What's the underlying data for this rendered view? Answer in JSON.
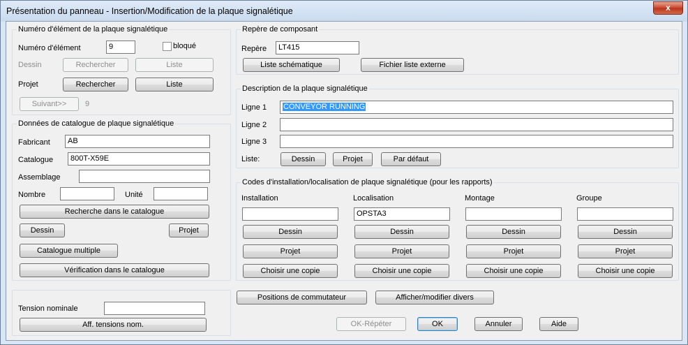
{
  "window": {
    "title": "Présentation du panneau - Insertion/Modification de la plaque signalétique",
    "close_glyph": "x"
  },
  "element_group": {
    "title": "Numéro d'élément de la plaque signalétique",
    "number_label": "Numéro d'élément",
    "number_value": "9",
    "locked_label": "bloqué",
    "drawing_label": "Dessin",
    "project_label": "Projet",
    "search_label": "Rechercher",
    "list_label": "Liste",
    "next_label": "Suivant>>",
    "next_value": "9"
  },
  "catalog_group": {
    "title": "Données de catalogue de plaque signalétique",
    "manufacturer_label": "Fabricant",
    "manufacturer_value": "AB",
    "catalog_label": "Catalogue",
    "catalog_value": "800T-X59E",
    "assembly_label": "Assemblage",
    "assembly_value": "",
    "count_label": "Nombre",
    "count_value": "",
    "unit_label": "Unité",
    "unit_value": "",
    "catalog_search_label": "Recherche dans le catalogue",
    "drawing_label": "Dessin",
    "project_label": "Projet",
    "multi_catalog_label": "Catalogue multiple",
    "catalog_check_label": "Vérification dans le catalogue"
  },
  "voltage_group": {
    "nominal_label": "Tension nominale",
    "nominal_value": "",
    "show_voltages_label": "Aff. tensions nom."
  },
  "component_tag_group": {
    "title": "Repère de composant",
    "tag_label": "Repère",
    "tag_value": "LT415",
    "schematic_list_label": "Liste schématique",
    "external_file_label": "Fichier liste externe"
  },
  "description_group": {
    "title": "Description de la plaque signalétique",
    "line1_label": "Ligne 1",
    "line1_value": "CONVEYOR RUNNING",
    "line2_label": "Ligne 2",
    "line2_value": "",
    "line3_label": "Ligne 3",
    "line3_value": "",
    "list_label": "Liste:",
    "drawing_label": "Dessin",
    "project_label": "Projet",
    "default_label": "Par défaut"
  },
  "codes_group": {
    "title": "Codes d'installation/localisation de plaque signalétique (pour les rapports)",
    "columns": [
      {
        "label": "Installation",
        "value": "",
        "drawing": "Dessin",
        "project": "Projet",
        "copy": "Choisir une copie"
      },
      {
        "label": "Localisation",
        "value": "OPSTA3",
        "drawing": "Dessin",
        "project": "Projet",
        "copy": "Choisir une copie"
      },
      {
        "label": "Montage",
        "value": "",
        "drawing": "Dessin",
        "project": "Projet",
        "copy": "Choisir une copie"
      },
      {
        "label": "Groupe",
        "value": "",
        "drawing": "Dessin",
        "project": "Projet",
        "copy": "Choisir une copie"
      }
    ]
  },
  "bottom": {
    "switch_positions_label": "Positions de commutateur",
    "misc_label": "Afficher/modifier divers",
    "ok_repeat_label": "OK-Répéter",
    "ok_label": "OK",
    "cancel_label": "Annuler",
    "help_label": "Aide"
  }
}
